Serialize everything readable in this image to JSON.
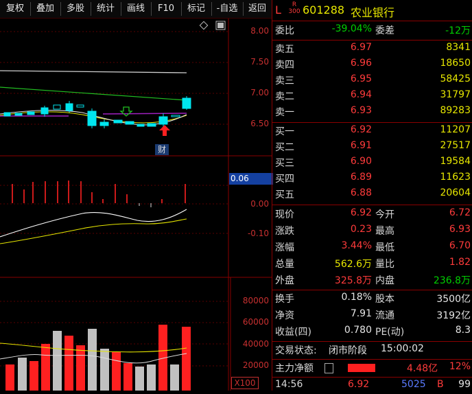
{
  "toolbar": {
    "items": [
      "复权",
      "叠加",
      "多股",
      "统计",
      "画线",
      "F10",
      "标记",
      "-自选",
      "返回"
    ]
  },
  "price_axis": [
    "8.00",
    "7.50",
    "7.00",
    "6.50"
  ],
  "macd_axis": [
    "0.06",
    "0.00",
    "-0.10"
  ],
  "vol_axis": [
    "80000",
    "60000",
    "40000",
    "20000",
    "X100"
  ],
  "event_marker": "财",
  "stock": {
    "l_label": "L",
    "r_label": "R",
    "r_sub": "300",
    "code": "601288",
    "name": "农业银行"
  },
  "ratio": {
    "wb_label": "委比",
    "wb_value": "-39.04%",
    "wc_label": "委差",
    "wc_value": "-12万"
  },
  "sell": [
    {
      "label": "卖五",
      "price": "6.97",
      "vol": "8341"
    },
    {
      "label": "卖四",
      "price": "6.96",
      "vol": "18650"
    },
    {
      "label": "卖三",
      "price": "6.95",
      "vol": "58425"
    },
    {
      "label": "卖二",
      "price": "6.94",
      "vol": "31797"
    },
    {
      "label": "卖一",
      "price": "6.93",
      "vol": "89283"
    }
  ],
  "buy": [
    {
      "label": "买一",
      "price": "6.92",
      "vol": "11207"
    },
    {
      "label": "买二",
      "price": "6.91",
      "vol": "27517"
    },
    {
      "label": "买三",
      "price": "6.90",
      "vol": "19584"
    },
    {
      "label": "买四",
      "price": "6.89",
      "vol": "11623"
    },
    {
      "label": "买五",
      "price": "6.88",
      "vol": "20604"
    }
  ],
  "quote": [
    {
      "l": "现价",
      "lv": "6.92",
      "r": "今开",
      "rv": "6.72"
    },
    {
      "l": "涨跌",
      "lv": "0.23",
      "r": "最高",
      "rv": "6.93"
    },
    {
      "l": "涨幅",
      "lv": "3.44%",
      "r": "最低",
      "rv": "6.70"
    },
    {
      "l": "总量",
      "lv": "562.6万",
      "r": "量比",
      "rv": "1.82"
    },
    {
      "l": "外盘",
      "lv": "325.8万",
      "r": "内盘",
      "rv": "236.8万"
    }
  ],
  "stats": [
    {
      "l": "换手",
      "lv": "0.18%",
      "r": "股本",
      "rv": "3500亿"
    },
    {
      "l": "净资",
      "lv": "7.91",
      "r": "流通",
      "rv": "3192亿"
    },
    {
      "l": "收益(四)",
      "lv": "0.780",
      "r": "PE(动)",
      "rv": "8.3"
    }
  ],
  "status": {
    "label": "交易状态:",
    "value": "闭市阶段",
    "time": "15:00:02"
  },
  "main_flow": {
    "label": "主力净额",
    "value": "4.48亿",
    "pct": "12%"
  },
  "tick": {
    "time": "14:56",
    "price": "6.92",
    "vol": "5025",
    "side": "B",
    "num": "99"
  },
  "colors": {
    "up": "#ff3b3b",
    "down": "#00d000",
    "neutral": "#e6e600",
    "bg": "#000000",
    "frame": "#8a0000",
    "candle_down": "#00e5ee"
  }
}
